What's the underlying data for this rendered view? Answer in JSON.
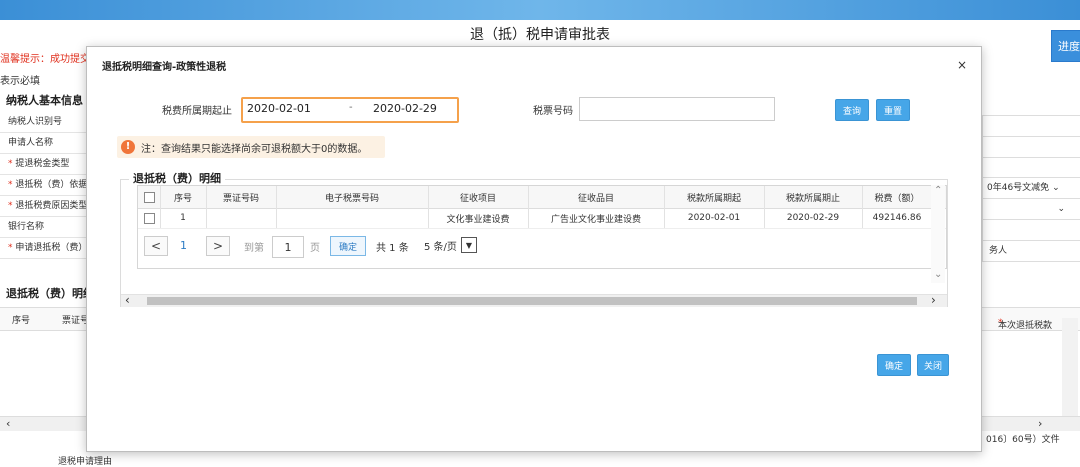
{
  "page": {
    "title": "退（抵）税申请审批表",
    "progress_label": "进度",
    "warning_text": "温馨提示：成功提交",
    "required_hint": "表示必填",
    "section_basic": "纳税人基本信息",
    "section_detail": "退抵税（费）明细",
    "bottom_label": "退税申请理由",
    "bottom_note": "016〕60号）文件"
  },
  "bg_form": {
    "rows": [
      {
        "label": "纳税人识别号"
      },
      {
        "label": "申请人名称"
      },
      {
        "label": "提退税金类型"
      },
      {
        "label": "退抵税（费）依据"
      },
      {
        "label": "退抵税费原因类型"
      },
      {
        "label": "银行名称"
      },
      {
        "label": "申请退抵税（费）"
      }
    ],
    "right_values": [
      "0年46号文减免",
      "务人"
    ]
  },
  "bg_grid": {
    "col_seq": "序号",
    "col_ticket": "票证号",
    "col_amount": "本次退抵税款"
  },
  "modal": {
    "title": "退抵税明细查询-政策性退税",
    "close_label": "×",
    "period_label": "税费所属期起止",
    "date_start": "2020-02-01",
    "date_separator": "-",
    "date_end": "2020-02-29",
    "ticket_label": "税票号码",
    "ticket_value": "",
    "query_button": "查询",
    "reset_button": "重置",
    "notice_icon": "!",
    "notice_text": "注：查询结果只能选择尚余可退税额大于0的数据。",
    "detail_legend": "退抵税（费）明细",
    "table": {
      "headers": [
        "序号",
        "票证号码",
        "电子税票号码",
        "征收项目",
        "征收品目",
        "税款所属期起",
        "税款所属期止",
        "税费（额）"
      ],
      "rows": [
        {
          "seq": "1",
          "ticket_no": "",
          "e_ticket_no": "",
          "item": "文化事业建设费",
          "sub_item": "广告业文化事业建设费",
          "period_start": "2020-02-01",
          "period_end": "2020-02-29",
          "amount": "492146.86"
        }
      ]
    },
    "pager": {
      "prev": "<",
      "current_page": "1",
      "next": ">",
      "goto_label": "到第",
      "goto_value": "1",
      "page_label": "页",
      "confirm_label": "确定",
      "total_label": "共 1 条",
      "page_size": "5 条/页"
    },
    "confirm_button": "确定",
    "close_button": "关闭"
  },
  "colors": {
    "accent_blue": "#46a6e8",
    "highlight_orange": "#f5a14b",
    "warning_red": "#e0301e"
  }
}
